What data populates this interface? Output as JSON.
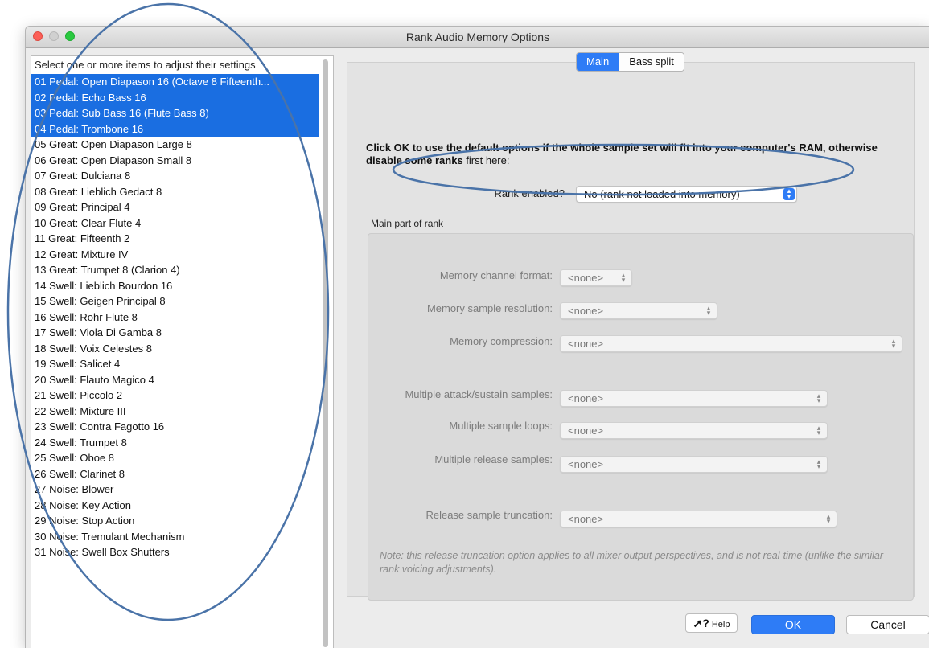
{
  "window": {
    "title": "Rank Audio Memory Options"
  },
  "list": {
    "header": "Select one or more items to adjust their settings",
    "items": [
      {
        "label": "01 Pedal: Open Diapason 16 (Octave 8 Fifteenth...",
        "selected": true
      },
      {
        "label": "02 Pedal: Echo Bass 16",
        "selected": true
      },
      {
        "label": "03 Pedal: Sub Bass 16 (Flute Bass 8)",
        "selected": true
      },
      {
        "label": "04 Pedal: Trombone 16",
        "selected": true
      },
      {
        "label": "05 Great: Open Diapason Large 8",
        "selected": false
      },
      {
        "label": "06 Great: Open Diapason Small 8",
        "selected": false
      },
      {
        "label": "07 Great: Dulciana 8",
        "selected": false
      },
      {
        "label": "08 Great: Lieblich Gedact 8",
        "selected": false
      },
      {
        "label": "09 Great: Principal 4",
        "selected": false
      },
      {
        "label": "10 Great: Clear Flute 4",
        "selected": false
      },
      {
        "label": "11 Great: Fifteenth 2",
        "selected": false
      },
      {
        "label": "12 Great: Mixture IV",
        "selected": false
      },
      {
        "label": "13 Great: Trumpet 8 (Clarion 4)",
        "selected": false
      },
      {
        "label": "14 Swell: Lieblich Bourdon 16",
        "selected": false
      },
      {
        "label": "15 Swell: Geigen Principal 8",
        "selected": false
      },
      {
        "label": "16 Swell: Rohr Flute 8",
        "selected": false
      },
      {
        "label": "17 Swell: Viola Di Gamba 8",
        "selected": false
      },
      {
        "label": "18 Swell: Voix Celestes 8",
        "selected": false
      },
      {
        "label": "19 Swell: Salicet 4",
        "selected": false
      },
      {
        "label": "20 Swell: Flauto Magico 4",
        "selected": false
      },
      {
        "label": "21 Swell: Piccolo 2",
        "selected": false
      },
      {
        "label": "22 Swell: Mixture III",
        "selected": false
      },
      {
        "label": "23 Swell: Contra Fagotto 16",
        "selected": false
      },
      {
        "label": "24 Swell: Trumpet 8",
        "selected": false
      },
      {
        "label": "25 Swell: Oboe 8",
        "selected": false
      },
      {
        "label": "26 Swell: Clarinet 8",
        "selected": false
      },
      {
        "label": "27 Noise: Blower",
        "selected": false
      },
      {
        "label": "28 Noise: Key Action",
        "selected": false
      },
      {
        "label": "29 Noise: Stop Action",
        "selected": false
      },
      {
        "label": "30 Noise: Tremulant Mechanism",
        "selected": false
      },
      {
        "label": "31 Noise: Swell Box Shutters",
        "selected": false
      }
    ]
  },
  "tabs": {
    "main": "Main",
    "bass_split": "Bass split"
  },
  "instructions": {
    "part1": "Click OK to use the default options if the whole sample set will fit into your computer's RAM, otherwise disable some ranks",
    "part2": " first here:"
  },
  "rank_enabled": {
    "label": "Rank enabled?",
    "value": "No (rank not loaded into memory)"
  },
  "main_part": {
    "group_label": "Main part of rank",
    "memory_channel_format": {
      "label": "Memory channel format:",
      "value": "<none>"
    },
    "memory_sample_resolution": {
      "label": "Memory sample resolution:",
      "value": "<none>"
    },
    "memory_compression": {
      "label": "Memory compression:",
      "value": "<none>"
    },
    "multiple_attack_sustain": {
      "label": "Multiple attack/sustain samples:",
      "value": "<none>"
    },
    "multiple_sample_loops": {
      "label": "Multiple sample loops:",
      "value": "<none>"
    },
    "multiple_release_samples": {
      "label": "Multiple release samples:",
      "value": "<none>"
    },
    "release_sample_truncation": {
      "label": "Release sample truncation:",
      "value": "<none>"
    },
    "note": "Note: this release truncation option applies to all mixer output perspectives, and is not real-time (unlike the similar rank voicing adjustments)."
  },
  "buttons": {
    "help": "Help",
    "ok": "OK",
    "cancel": "Cancel"
  },
  "colors": {
    "accent": "#2e7cf6",
    "selection": "#1a6ee1",
    "annotation": "#4a73a8"
  }
}
